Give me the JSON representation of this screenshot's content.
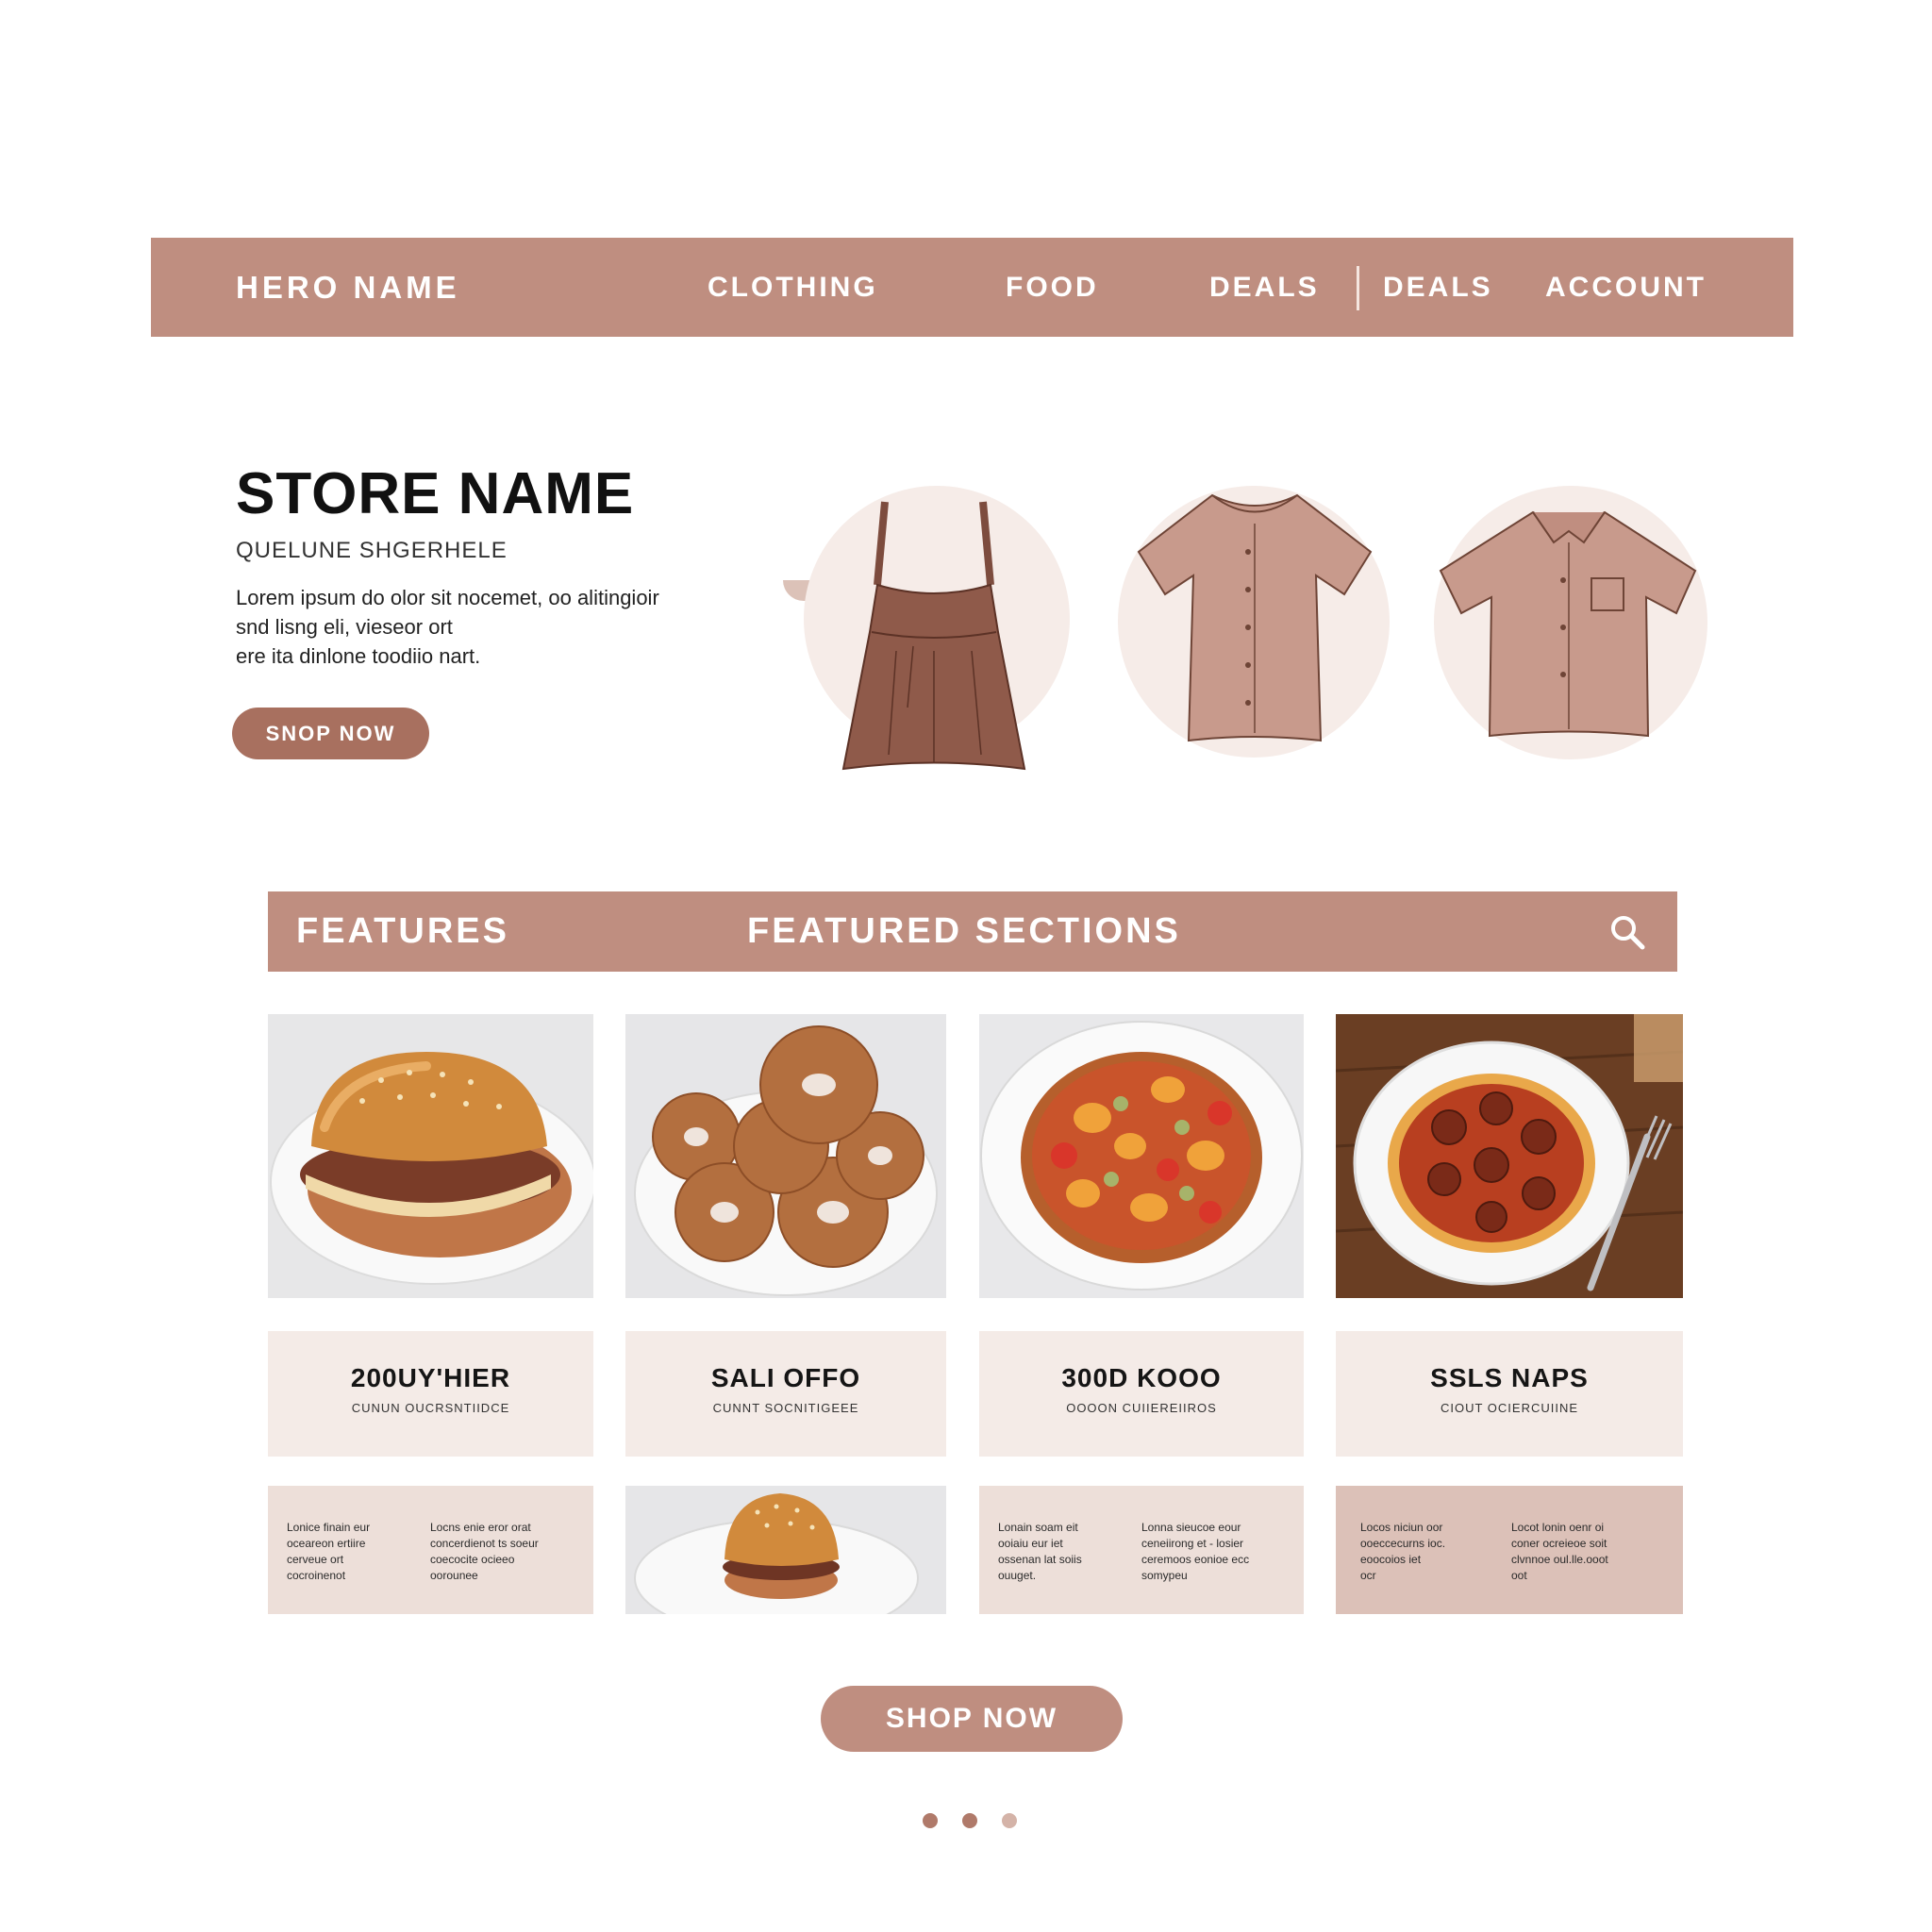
{
  "header": {
    "brand": "HERO NAME",
    "nav": [
      "CLOTHING",
      "FOOD",
      "DEALS",
      "DEALS",
      "ACCOUNT"
    ]
  },
  "hero": {
    "title": "STORE NAME",
    "subtitle": "QUELUNE SHGERHELE",
    "description": [
      "Lorem ipsum do olor sit nocemet, oo alitingioir",
      "snd lisng eli, vieseor ort",
      "ere ita dinlone toodiio nart."
    ],
    "cta": "SNOP NOW",
    "garments": [
      "dress-icon",
      "tshirt-icon",
      "polo-shirt-icon"
    ]
  },
  "features": {
    "left_label": "FEATURES",
    "center_label": "FEATURED SECTIONS",
    "search_icon": "search-icon"
  },
  "products": [
    {
      "image": "burger",
      "title": "200UY'HIER",
      "subtitle": "CUNUN OUCRSNTIIDCE"
    },
    {
      "image": "donuts",
      "title": "SALI OFFO",
      "subtitle": "CUNNT SOCNITIGEEE"
    },
    {
      "image": "pizza",
      "title": "300D KOOO",
      "subtitle": "OOOON CUIIEREIIROS"
    },
    {
      "image": "pizza-wood",
      "title": "SSLS NAPS",
      "subtitle": "CIOUT OCIERCUIINE"
    }
  ],
  "info_blocks": [
    {
      "col1": [
        "Lonice finain eur",
        "oceareon ertiire",
        "cerveue ort",
        "cocroinenot"
      ],
      "col2": [
        "Locns enie eror orat",
        "concerdienot ts soeur",
        "coecocite ocieeo",
        "oorounee"
      ]
    },
    {
      "image": "burger-small"
    },
    {
      "col1": [
        "Lonain soam eit",
        "ooiaiu eur iet",
        "ossenan lat soiis",
        "ouuget."
      ],
      "col2": [
        "Lonna sieucoe eour",
        "ceneiirong et - losier",
        "ceremoos eonioe ecc",
        "somypeu"
      ]
    },
    {
      "col1": [
        "Locos niciun oor",
        "ooeccecurns ioc.",
        "eoocoios iet",
        "ocr"
      ],
      "col2": [
        "Locot lonin oenr oi",
        "coner ocreieoe soit",
        "clvnnoe oul.lle.ooot",
        "oot"
      ]
    }
  ],
  "cta_bottom": "SHOP NOW",
  "pagination": {
    "pages": 3,
    "active": 1
  },
  "colors": {
    "accent": "#bf8e80",
    "accent_dark": "#a8705f",
    "card_bg": "#f4ebe7"
  }
}
